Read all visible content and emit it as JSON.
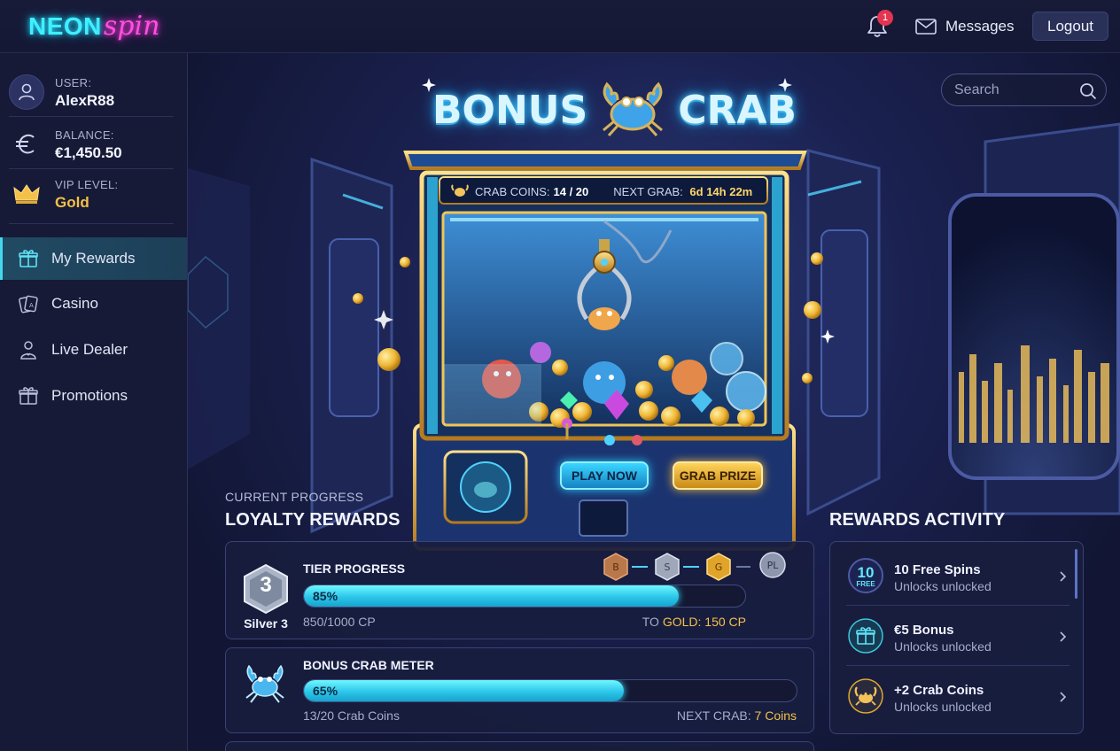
{
  "header": {
    "logo_main": "NEON",
    "logo_accent": "spin",
    "notification_count": "1",
    "messages_label": "Messages",
    "logout_label": "Logout"
  },
  "sidebar": {
    "user_label": "USER:",
    "user_value": "AlexR88",
    "balance_label": "BALANCE:",
    "balance_value": "€1,450.50",
    "vip_label": "VIP LEVEL:",
    "vip_value": "Gold",
    "nav": [
      {
        "label": "My Rewards",
        "icon": "gift-icon",
        "active": true
      },
      {
        "label": "Casino",
        "icon": "cards-icon",
        "active": false
      },
      {
        "label": "Live Dealer",
        "icon": "dealer-icon",
        "active": false
      },
      {
        "label": "Promotions",
        "icon": "gift-box-icon",
        "active": false
      }
    ]
  },
  "search": {
    "placeholder": "Search"
  },
  "hero": {
    "title_left": "BONUS",
    "title_right": "CRAB",
    "coins_label": "CRAB COINS:",
    "coins_value": "14 / 20",
    "next_grab_label": "NEXT GRAB:",
    "next_grab_value": "6d 14h 22m",
    "play_label": "PLAY NOW",
    "grab_label": "GRAB PRIZE"
  },
  "loyalty": {
    "kicker": "CURRENT PROGRESS",
    "title": "LOYALTY REWARDS",
    "tier": {
      "title": "TIER PROGRESS",
      "badge_number": "3",
      "badge_name": "Silver 3",
      "percent_label": "85%",
      "progress": 0.85,
      "points": "850/1000 CP",
      "to_prefix": "TO",
      "to_value": "GOLD: 150 CP",
      "chain": [
        "B",
        "S",
        "G",
        "PL"
      ]
    },
    "crab_meter": {
      "title": "BONUS CRAB METER",
      "percent_label": "65%",
      "progress": 0.65,
      "coins": "13/20 Crab Coins",
      "next_prefix": "NEXT CRAB:",
      "next_value": "7 Coins"
    }
  },
  "activity": {
    "title": "REWARDS ACTIVITY",
    "items": [
      {
        "icon_top": "10",
        "icon_bottom": "FREE",
        "name": "10 Free Spins",
        "sub": "Unlocks unlocked"
      },
      {
        "name": "€5 Bonus",
        "sub": "Unlocks unlocked"
      },
      {
        "name": "+2 Crab Coins",
        "sub": "Unlocks unlocked"
      }
    ]
  },
  "colors": {
    "accent_cyan": "#3ff0ff",
    "accent_pink": "#ff4fe1",
    "gold": "#f5c04a",
    "background": "#141833"
  }
}
